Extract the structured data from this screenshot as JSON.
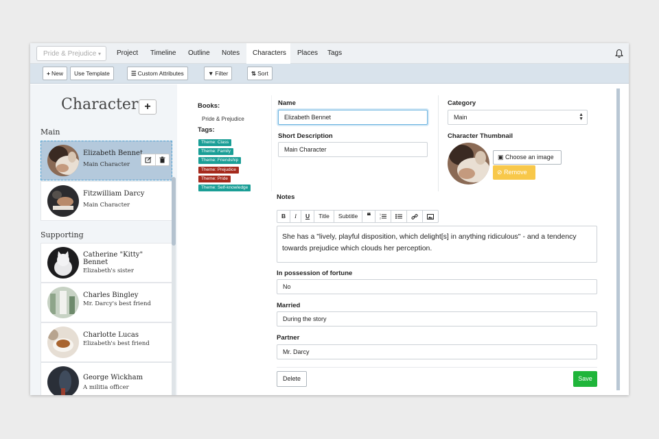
{
  "nav": {
    "book_select": "Pride & Prejudice",
    "links": [
      "Project",
      "Timeline",
      "Outline",
      "Notes",
      "Characters",
      "Places",
      "Tags"
    ],
    "active": "Characters"
  },
  "toolbar": {
    "new_label": "New",
    "template_label": "Use Template",
    "custom_attr_label": "Custom Attributes",
    "filter_label": "Filter",
    "sort_label": "Sort"
  },
  "sidebar": {
    "title": "Characters",
    "groups": [
      {
        "label": "Main",
        "characters": [
          {
            "name": "Elizabeth Bennet",
            "desc": "Main Character",
            "selected": true
          },
          {
            "name": "Fitzwilliam Darcy",
            "desc": "Main Character",
            "selected": false
          }
        ]
      },
      {
        "label": "Supporting",
        "characters": [
          {
            "name": "Catherine \"Kitty\" Bennet",
            "desc": "Elizabeth's sister"
          },
          {
            "name": "Charles Bingley",
            "desc": "Mr. Darcy's best friend"
          },
          {
            "name": "Charlotte Lucas",
            "desc": "Elizabeth's best friend"
          },
          {
            "name": "George Wickham",
            "desc": "A militia officer"
          }
        ]
      }
    ]
  },
  "detail": {
    "books_label": "Books:",
    "book": "Pride & Prejudice",
    "tags_label": "Tags:",
    "tags": [
      {
        "label": "Theme: Class",
        "color": "#1a9e96"
      },
      {
        "label": "Theme: Family",
        "color": "#1a9e96"
      },
      {
        "label": "Theme: Friendship",
        "color": "#1a9e96"
      },
      {
        "label": "Theme: Prejudice",
        "color": "#a52a1d"
      },
      {
        "label": "Theme: Pride",
        "color": "#a52a1d"
      },
      {
        "label": "Theme: Self-knowledge",
        "color": "#1a9e96"
      }
    ],
    "name_label": "Name",
    "name_value": "Elizabeth Bennet",
    "short_desc_label": "Short Description",
    "short_desc_value": "Main Character",
    "category_label": "Category",
    "category_value": "Main",
    "thumbnail_label": "Character Thumbnail",
    "choose_image_label": "Choose an image",
    "remove_label": "Remove",
    "notes_label": "Notes",
    "editor_tools": [
      "B",
      "I",
      "U",
      "Title",
      "Subtitle",
      "quote-icon",
      "ordered-list-icon",
      "bullet-list-icon",
      "link-icon",
      "image-icon"
    ],
    "notes_text": "She has a \"lively, playful disposition, which delight[s] in anything ridiculous\" - and a tendency towards prejudice which clouds her perception.",
    "fortune_label": "In possession of fortune",
    "fortune_value": "No",
    "married_label": "Married",
    "married_value": "During the story",
    "partner_label": "Partner",
    "partner_value": "Mr. Darcy",
    "delete_label": "Delete",
    "save_label": "Save"
  },
  "colors": {
    "accent_blue": "#4a9ed0",
    "save_green": "#1fb53a",
    "remove_yellow": "#f8c84a",
    "toolbar_bg": "#d9e3ec"
  }
}
